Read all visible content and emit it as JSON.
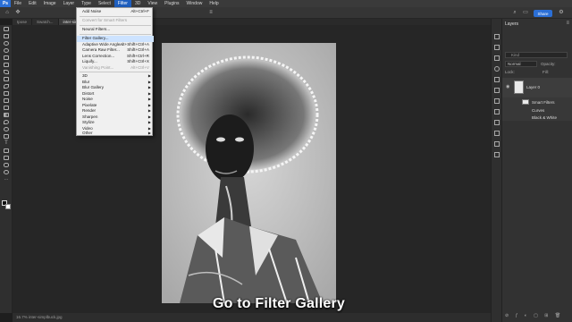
{
  "menubar": {
    "logo": "Ps",
    "items": [
      "File",
      "Edit",
      "Image",
      "Layer",
      "Type",
      "Select",
      "Filter",
      "3D",
      "View",
      "Plugins",
      "Window",
      "Help"
    ],
    "active_index": 6
  },
  "optionsbar": {
    "share_label": "Share"
  },
  "doc_tabs": [
    {
      "label": "tpose"
    },
    {
      "label": "Swatch..."
    },
    {
      "label": "inter-simplbuck.jpg"
    }
  ],
  "filter_menu": {
    "items": [
      {
        "label": "Add Noise",
        "shortcut": "Alt+Ctrl+F",
        "disabled": false
      },
      {
        "label": "Convert for Smart Filters",
        "shortcut": "",
        "disabled": true
      },
      {
        "label": "Neural Filters...",
        "shortcut": "",
        "disabled": false
      },
      {
        "label": "Filter Gallery...",
        "shortcut": "",
        "disabled": false,
        "highlighted": true
      },
      {
        "label": "Adaptive Wide Angle...",
        "shortcut": "Alt+Shift+Ctrl+A",
        "disabled": false
      },
      {
        "label": "Camera Raw Filter...",
        "shortcut": "Shift+Ctrl+A",
        "disabled": false
      },
      {
        "label": "Lens Correction...",
        "shortcut": "Shift+Ctrl+R",
        "disabled": false
      },
      {
        "label": "Liquify...",
        "shortcut": "Shift+Ctrl+X",
        "disabled": false
      },
      {
        "label": "Vanishing Point...",
        "shortcut": "Alt+Ctrl+V",
        "disabled": true
      },
      {
        "label": "3D",
        "submenu": true
      },
      {
        "label": "Blur",
        "submenu": true
      },
      {
        "label": "Blur Gallery",
        "submenu": true
      },
      {
        "label": "Distort",
        "submenu": true
      },
      {
        "label": "Noise",
        "submenu": true
      },
      {
        "label": "Pixelate",
        "submenu": true
      },
      {
        "label": "Render",
        "submenu": true
      },
      {
        "label": "Sharpen",
        "submenu": true
      },
      {
        "label": "Stylize",
        "submenu": true
      },
      {
        "label": "Video",
        "submenu": true
      },
      {
        "label": "Other",
        "submenu": true
      }
    ]
  },
  "layers_panel": {
    "tab_label": "Layers",
    "search_placeholder": "Kind",
    "blend_mode": "Normal",
    "opacity_label": "Opacity:",
    "lock_label": "Lock:",
    "fill_label": "Fill:",
    "layers": [
      {
        "name": "Layer 0"
      },
      {
        "name": "Smart Filters"
      },
      {
        "name": "Curves"
      },
      {
        "name": "Black & White"
      }
    ]
  },
  "statusbar": {
    "text": "16.7%    inter-simplbuck.jpg"
  },
  "caption": {
    "text": "Go to Filter Gallery"
  }
}
